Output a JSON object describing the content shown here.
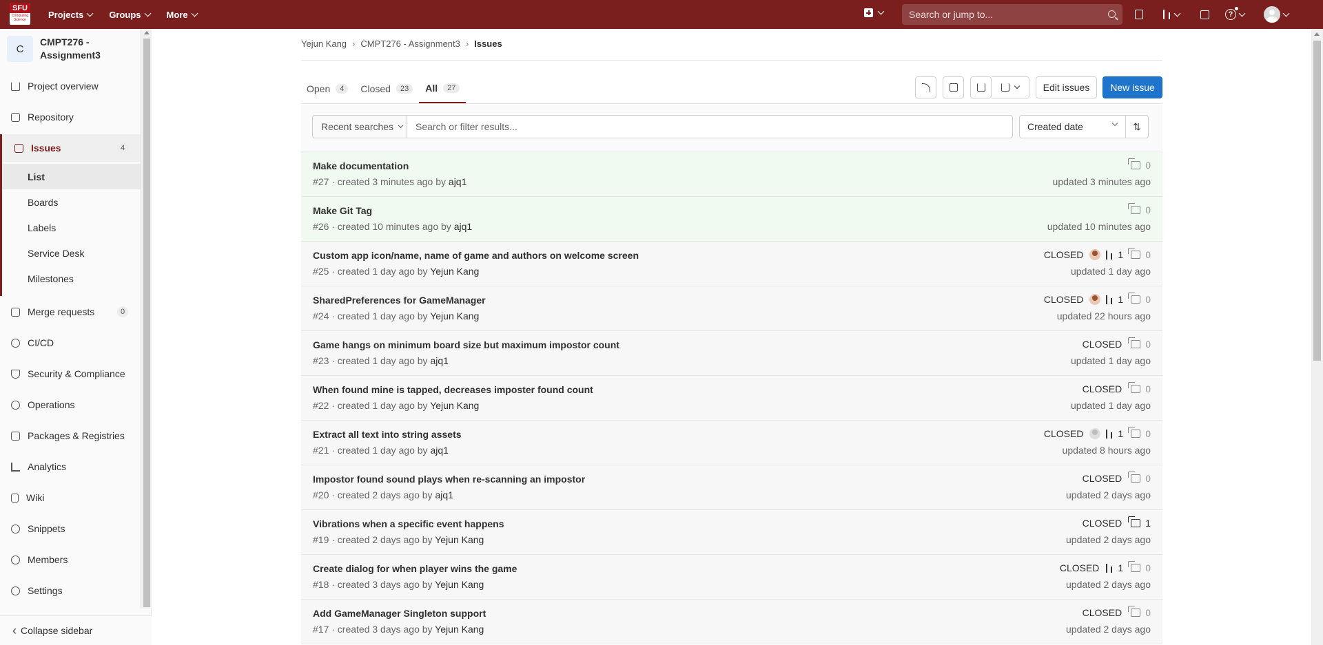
{
  "topbar": {
    "logo_text": "SFU",
    "logo_sub": "Computing Science",
    "nav": [
      "Projects",
      "Groups",
      "More"
    ],
    "search_placeholder": "Search or jump to...",
    "accent_color": "#7a1e1e"
  },
  "sidebar": {
    "project_initial": "C",
    "project_name": "CMPT276 - Assignment3",
    "items": [
      {
        "label": "Project overview",
        "icon": "home-icon"
      },
      {
        "label": "Repository",
        "icon": "doc-icon"
      },
      {
        "label": "Issues",
        "icon": "issues-icon",
        "badge": "4"
      },
      {
        "label": "Merge requests",
        "icon": "merge-request-icon",
        "badge": "0"
      },
      {
        "label": "CI/CD",
        "icon": "rocket-icon"
      },
      {
        "label": "Security & Compliance",
        "icon": "shield-icon"
      },
      {
        "label": "Operations",
        "icon": "cloud-icon"
      },
      {
        "label": "Packages & Registries",
        "icon": "package-icon"
      },
      {
        "label": "Analytics",
        "icon": "chart-icon"
      },
      {
        "label": "Wiki",
        "icon": "book-icon"
      },
      {
        "label": "Snippets",
        "icon": "scissors-icon"
      },
      {
        "label": "Members",
        "icon": "users-icon"
      },
      {
        "label": "Settings",
        "icon": "gear-icon"
      }
    ],
    "issue_sub": [
      "List",
      "Boards",
      "Labels",
      "Service Desk",
      "Milestones"
    ],
    "collapse_label": "Collapse sidebar"
  },
  "breadcrumb": [
    "Yejun Kang",
    "CMPT276 - Assignment3",
    "Issues"
  ],
  "tabs": [
    {
      "label": "Open",
      "count": "4"
    },
    {
      "label": "Closed",
      "count": "23"
    },
    {
      "label": "All",
      "count": "27"
    }
  ],
  "actions": {
    "edit_label": "Edit issues",
    "new_label": "New issue"
  },
  "filter": {
    "recent_label": "Recent searches",
    "placeholder": "Search or filter results...",
    "sort_label": "Created date"
  },
  "issues": [
    {
      "title": "Make documentation",
      "meta": "#27 · created 3 minutes ago by",
      "author": "ajq1",
      "closed": "",
      "mr": "",
      "comments": "0",
      "updated": "updated 3 minutes ago",
      "fresh": true,
      "assignee": ""
    },
    {
      "title": "Make Git Tag",
      "meta": "#26 · created 10 minutes ago by",
      "author": "ajq1",
      "closed": "",
      "mr": "",
      "comments": "0",
      "updated": "updated 10 minutes ago",
      "fresh": true,
      "assignee": ""
    },
    {
      "title": "Custom app icon/name, name of game and authors on welcome screen",
      "meta": "#25 · created 1 day ago by",
      "author": "Yejun Kang",
      "closed": "CLOSED",
      "mr": "1",
      "comments": "0",
      "updated": "updated 1 day ago",
      "fresh": false,
      "assignee": "photo"
    },
    {
      "title": "SharedPreferences for GameManager",
      "meta": "#24 · created 1 day ago by",
      "author": "Yejun Kang",
      "closed": "CLOSED",
      "mr": "1",
      "comments": "0",
      "updated": "updated 22 hours ago",
      "fresh": false,
      "assignee": "photo"
    },
    {
      "title": "Game hangs on minimum board size but maximum impostor count",
      "meta": "#23 · created 1 day ago by",
      "author": "ajq1",
      "closed": "CLOSED",
      "mr": "",
      "comments": "0",
      "updated": "updated 1 day ago",
      "fresh": false,
      "assignee": ""
    },
    {
      "title": "When found mine is tapped, decreases imposter found count",
      "meta": "#22 · created 1 day ago by",
      "author": "Yejun Kang",
      "closed": "CLOSED",
      "mr": "",
      "comments": "0",
      "updated": "updated 1 day ago",
      "fresh": false,
      "assignee": ""
    },
    {
      "title": "Extract all text into string assets",
      "meta": "#21 · created 1 day ago by",
      "author": "ajq1",
      "closed": "CLOSED",
      "mr": "1",
      "comments": "0",
      "updated": "updated 8 hours ago",
      "fresh": false,
      "assignee": "grey"
    },
    {
      "title": "Impostor found sound plays when re-scanning an impostor",
      "meta": "#20 · created 2 days ago by",
      "author": "ajq1",
      "closed": "CLOSED",
      "mr": "",
      "comments": "0",
      "updated": "updated 2 days ago",
      "fresh": false,
      "assignee": ""
    },
    {
      "title": "Vibrations when a specific event happens",
      "meta": "#19 · created 2 days ago by",
      "author": "Yejun Kang",
      "closed": "CLOSED",
      "mr": "",
      "comments": "1",
      "updated": "updated 2 days ago",
      "fresh": false,
      "assignee": ""
    },
    {
      "title": "Create dialog for when player wins the game",
      "meta": "#18 · created 3 days ago by",
      "author": "Yejun Kang",
      "closed": "CLOSED",
      "mr": "1",
      "comments": "0",
      "updated": "updated 2 days ago",
      "fresh": false,
      "assignee": ""
    },
    {
      "title": "Add GameManager Singleton support",
      "meta": "#17 · created 3 days ago by",
      "author": "Yejun Kang",
      "closed": "CLOSED",
      "mr": "",
      "comments": "0",
      "updated": "updated 2 days ago",
      "fresh": false,
      "assignee": ""
    }
  ]
}
